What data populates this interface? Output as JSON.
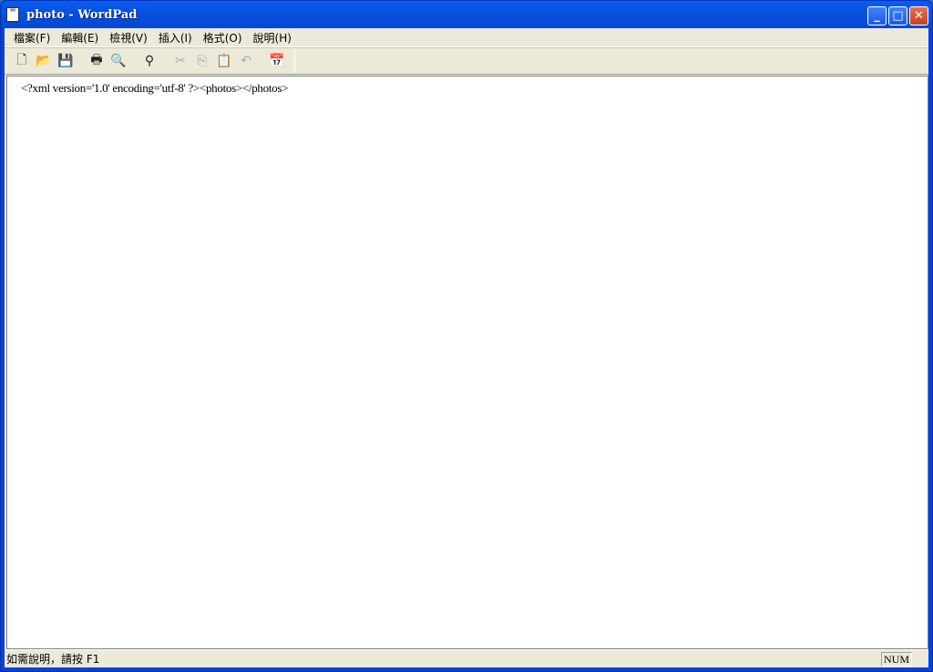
{
  "window": {
    "title": "photo - WordPad",
    "minimize": "_",
    "maximize": "□",
    "close": "✕"
  },
  "menu": [
    "檔案(F)",
    "編輯(E)",
    "檢視(V)",
    "插入(I)",
    "格式(O)",
    "說明(H)"
  ],
  "toolbar": [
    {
      "icon": "new-icon",
      "glyph": "🗋",
      "enabled": true
    },
    {
      "icon": "open-icon",
      "glyph": "📂",
      "enabled": true
    },
    {
      "icon": "save-icon",
      "glyph": "💾",
      "enabled": true
    },
    {
      "icon": "print-icon",
      "glyph": "🖶",
      "enabled": true
    },
    {
      "icon": "print-preview-icon",
      "glyph": "🔍",
      "enabled": true
    },
    {
      "icon": "find-icon",
      "glyph": "⚲",
      "enabled": true
    },
    {
      "icon": "cut-icon",
      "glyph": "✂",
      "enabled": false
    },
    {
      "icon": "copy-icon",
      "glyph": "⎘",
      "enabled": false
    },
    {
      "icon": "paste-icon",
      "glyph": "📋",
      "enabled": true
    },
    {
      "icon": "undo-icon",
      "glyph": "↶",
      "enabled": false
    },
    {
      "icon": "date-time-icon",
      "glyph": "📅",
      "enabled": true
    }
  ],
  "document": {
    "content": "<?xml version='1.0' encoding='utf-8' ?><photos></photos>"
  },
  "status": {
    "help": "如需說明，請按 F1",
    "num": "NUM"
  }
}
